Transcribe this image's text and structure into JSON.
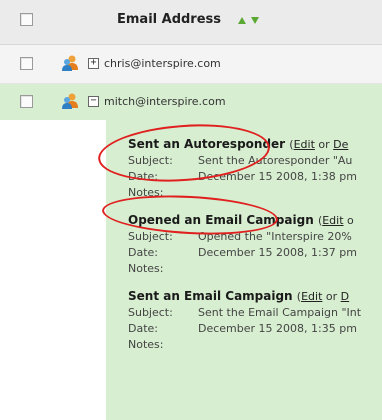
{
  "header": {
    "column_label": "Email Address"
  },
  "contacts": [
    {
      "email": "chris@interspire.com",
      "expanded": false,
      "expander_symbol": "+"
    },
    {
      "email": "mitch@interspire.com",
      "expanded": true,
      "expander_symbol": "−"
    }
  ],
  "activities": [
    {
      "title": "Sent an Autoresponder",
      "paren_open": "(",
      "edit_label": "Edit",
      "or_text": " or ",
      "delete_label": "De",
      "subject_label": "Subject:",
      "subject_value": "Sent the Autoresponder \"Au",
      "date_label": "Date:",
      "date_value": "December 15 2008, 1:38 pm",
      "notes_label": "Notes:"
    },
    {
      "title": "Opened an Email Campaign",
      "paren_open": "(",
      "edit_label": "Edit",
      "or_text": " o",
      "delete_label": "",
      "subject_label": "Subject:",
      "subject_value": "Opened the \"Interspire 20%",
      "date_label": "Date:",
      "date_value": "December 15 2008, 1:37 pm",
      "notes_label": "Notes:"
    },
    {
      "title": "Sent an Email Campaign",
      "paren_open": "(",
      "edit_label": "Edit",
      "or_text": " or ",
      "delete_label": "D",
      "subject_label": "Subject:",
      "subject_value": "Sent the Email Campaign \"Int",
      "date_label": "Date:",
      "date_value": "December 15 2008, 1:35 pm",
      "notes_label": "Notes:"
    }
  ],
  "colors": {
    "expanded_row_bg": "#d7eed1",
    "header_bg": "#ebebeb",
    "highlight": "#e0201f",
    "sort_arrow": "#5aa832"
  },
  "icons": {
    "sort": "sort-arrows-icon",
    "contact": "contact-people-icon"
  }
}
